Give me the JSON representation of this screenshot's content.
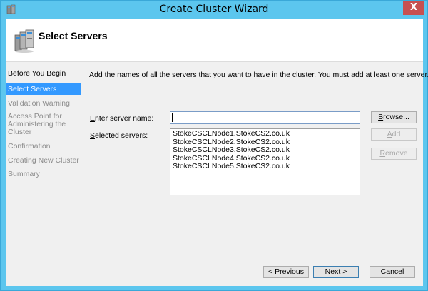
{
  "window": {
    "title": "Create Cluster Wizard",
    "close_glyph": "X"
  },
  "header": {
    "title": "Select Servers",
    "icon": "cluster-servers-icon"
  },
  "nav": {
    "items": [
      {
        "label": "Before You Begin",
        "state": "done"
      },
      {
        "label": "Select Servers",
        "state": "active"
      },
      {
        "label": "Validation Warning",
        "state": "pending"
      },
      {
        "label": "Access Point for Administering the Cluster",
        "state": "pending"
      },
      {
        "label": "Confirmation",
        "state": "pending"
      },
      {
        "label": "Creating New Cluster",
        "state": "pending"
      },
      {
        "label": "Summary",
        "state": "pending"
      }
    ]
  },
  "main": {
    "intro": "Add the names of all the servers that you want to have in the cluster. You must add at least one server.",
    "server_name_label_underlined": "E",
    "server_name_label_rest": "nter server name:",
    "server_name_value": "",
    "selected_label_underlined": "S",
    "selected_label_rest": "elected servers:",
    "selected_servers": [
      "StokeCSCLNode1.StokeCS2.co.uk",
      "StokeCSCLNode2.StokeCS2.co.uk",
      "StokeCSCLNode3.StokeCS2.co.uk",
      "StokeCSCLNode4.StokeCS2.co.uk",
      "StokeCSCLNode5.StokeCS2.co.uk"
    ],
    "browse_label_underlined": "B",
    "browse_label_rest": "rowse...",
    "add_label_underlined": "A",
    "add_label_rest": "dd",
    "remove_label_underlined": "R",
    "remove_label_rest": "emove"
  },
  "footer": {
    "previous_prefix": "< ",
    "previous_underlined": "P",
    "previous_rest": "revious",
    "next_underlined": "N",
    "next_rest": "ext >",
    "cancel_label": "Cancel"
  },
  "colors": {
    "frame": "#5cc6ee",
    "selection": "#3399ff",
    "close": "#c75050"
  }
}
